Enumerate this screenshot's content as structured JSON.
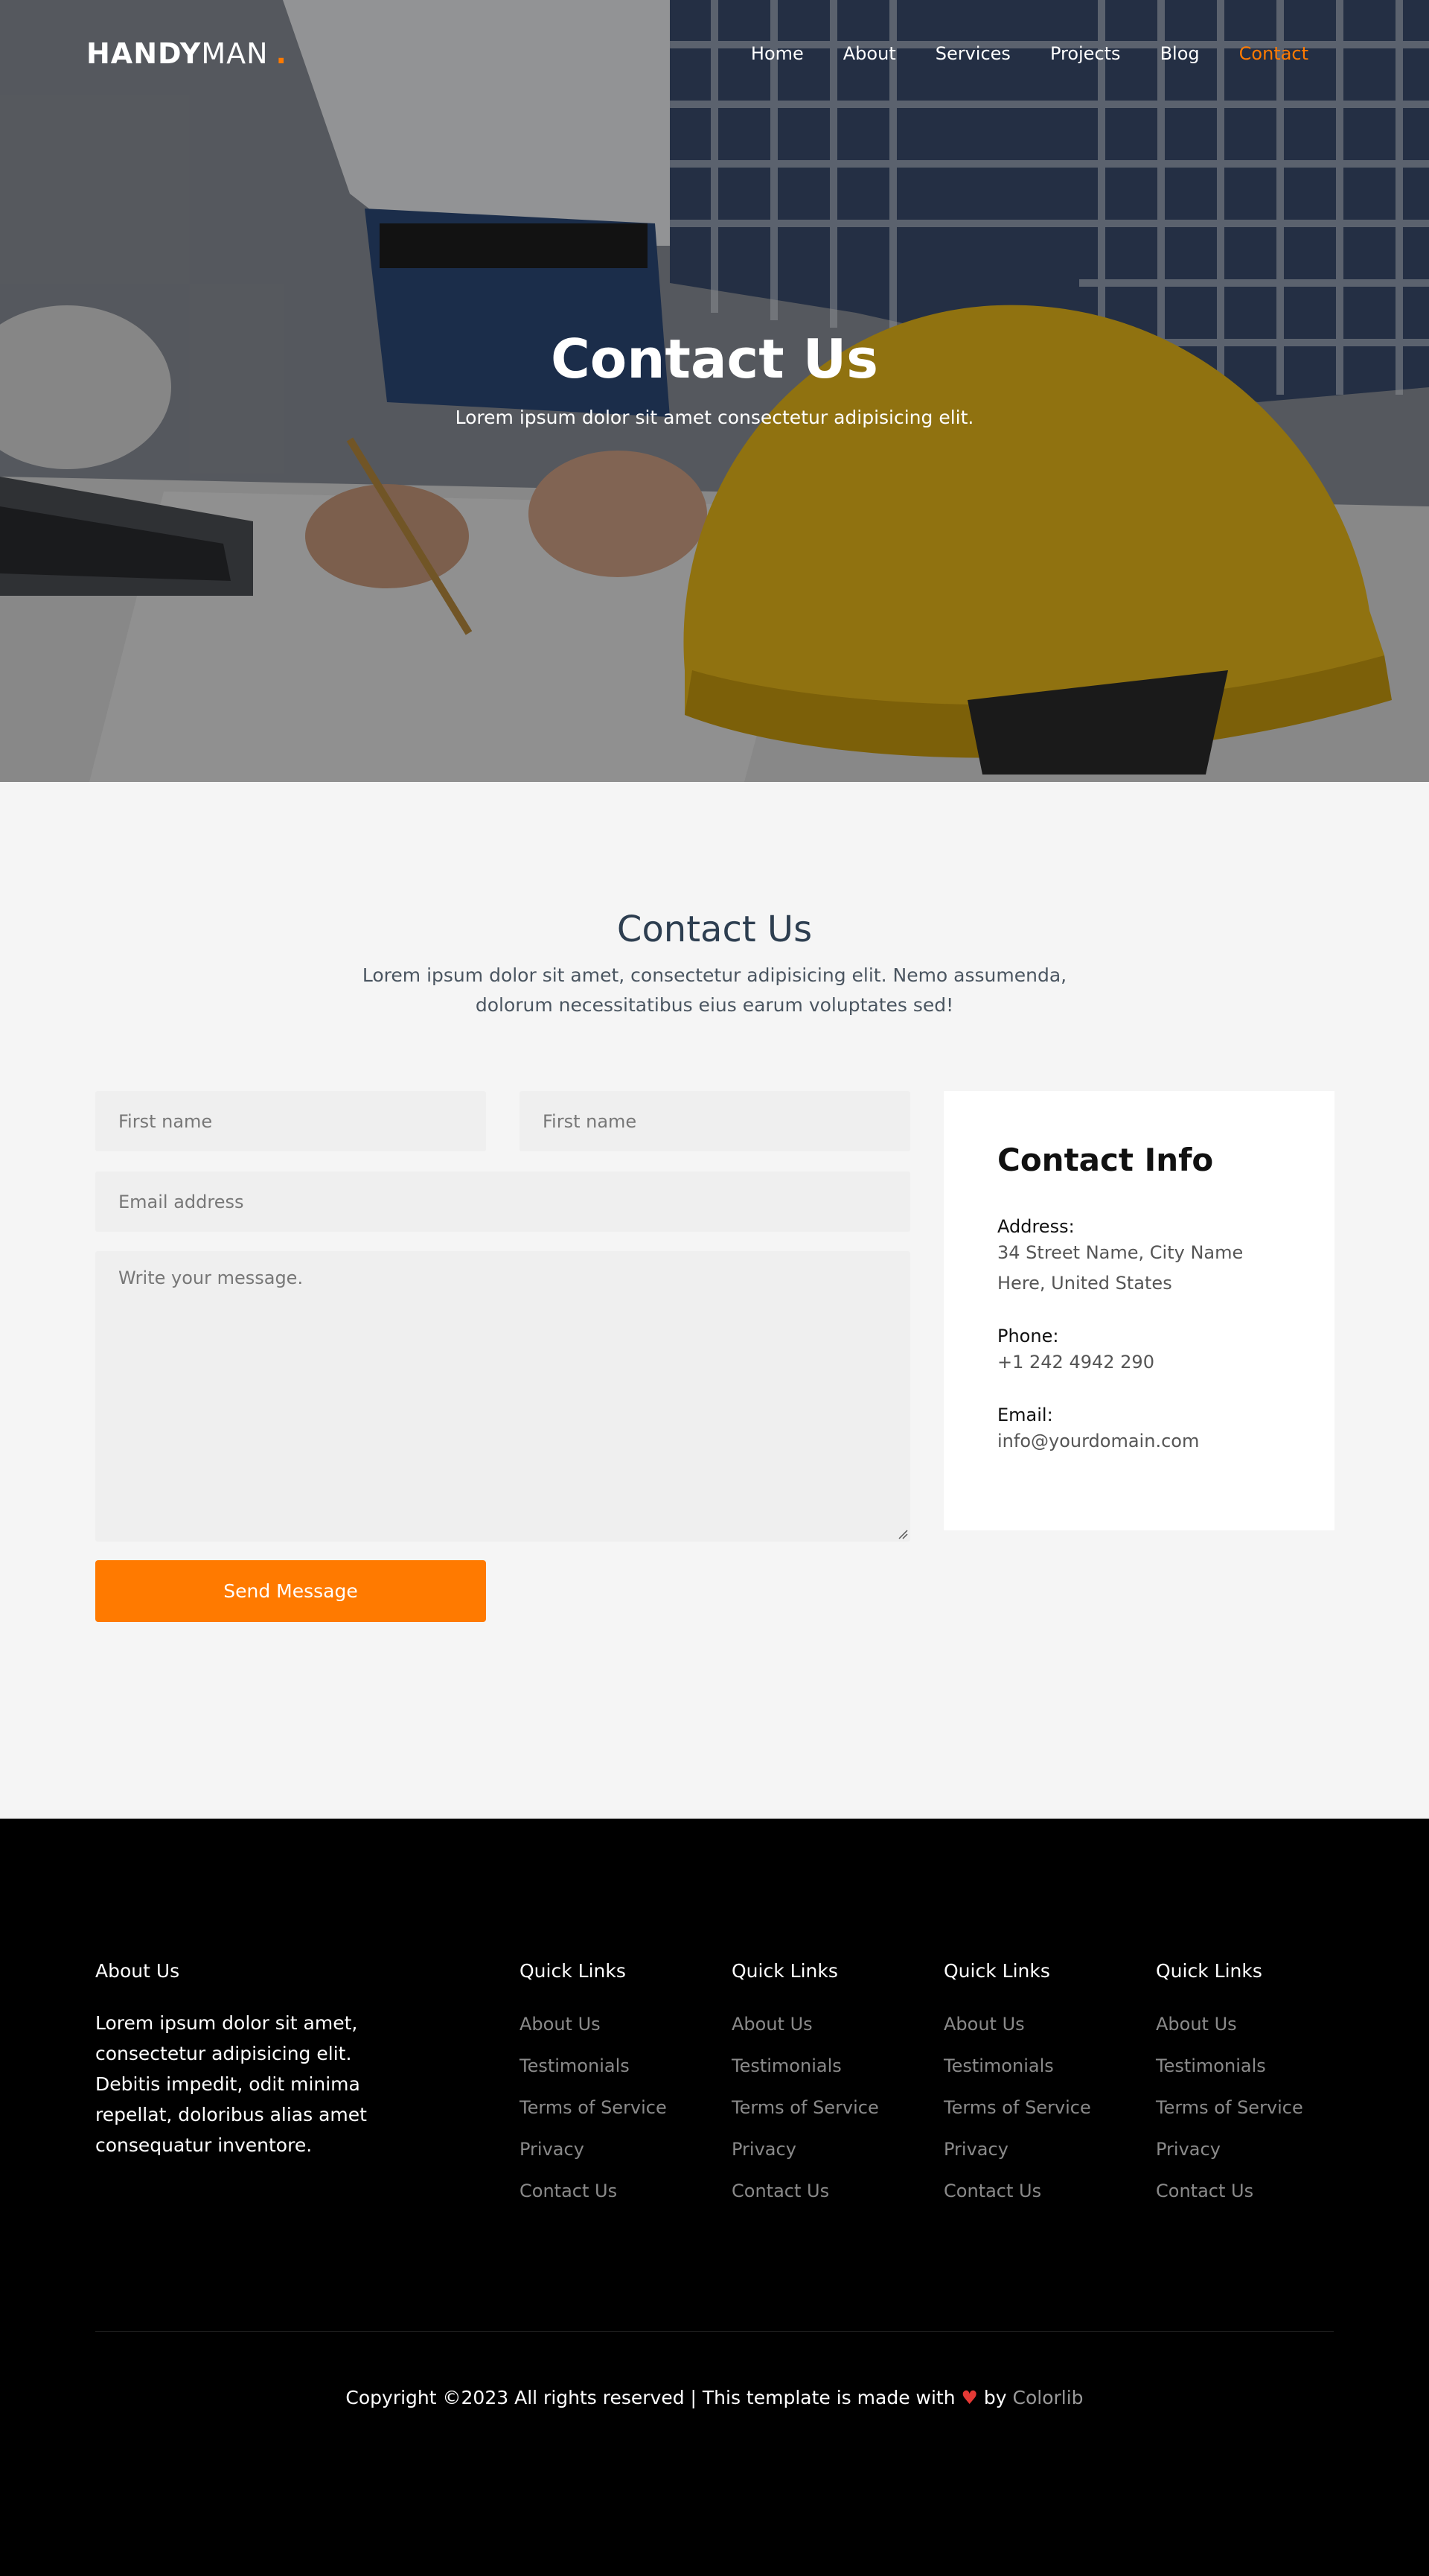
{
  "brand": {
    "bold": "HANDY",
    "light": "MAN",
    "dot": "."
  },
  "nav": {
    "items": [
      {
        "label": "Home"
      },
      {
        "label": "About"
      },
      {
        "label": "Services"
      },
      {
        "label": "Projects"
      },
      {
        "label": "Blog"
      },
      {
        "label": "Contact"
      }
    ],
    "active_color": "#ff7a00"
  },
  "hero": {
    "title": "Contact Us",
    "subtitle": "Lorem ipsum dolor sit amet consectetur adipisicing elit."
  },
  "contact": {
    "title": "Contact Us",
    "description": "Lorem ipsum dolor sit amet, consectetur adipisicing elit. Nemo assumenda, dolorum necessitatibus eius earum voluptates sed!",
    "form": {
      "first_name_placeholder": "First name",
      "second_name_placeholder": "First name",
      "email_placeholder": "Email address",
      "message_placeholder": "Write your message.",
      "send_label": "Send Message",
      "button_color": "#ff7a00"
    },
    "info": {
      "title": "Contact Info",
      "address_label": "Address:",
      "address_line1": "34 Street Name, City Name",
      "address_line2": "Here, United States",
      "phone_label": "Phone:",
      "phone": "+1 242 4942 290",
      "email_label": "Email:",
      "email": "info@yourdomain.com"
    }
  },
  "footer": {
    "about_heading": "About Us",
    "about_text": "Lorem ipsum dolor sit amet, consectetur adipisicing elit. Debitis impedit, odit minima repellat, doloribus alias amet consequatur inventore.",
    "link_columns": [
      {
        "heading": "Quick Links",
        "links": [
          "About Us",
          "Testimonials",
          "Terms of Service",
          "Privacy",
          "Contact Us"
        ]
      },
      {
        "heading": "Quick Links",
        "links": [
          "About Us",
          "Testimonials",
          "Terms of Service",
          "Privacy",
          "Contact Us"
        ]
      },
      {
        "heading": "Quick Links",
        "links": [
          "About Us",
          "Testimonials",
          "Terms of Service",
          "Privacy",
          "Contact Us"
        ]
      },
      {
        "heading": "Quick Links",
        "links": [
          "About Us",
          "Testimonials",
          "Terms of Service",
          "Privacy",
          "Contact Us"
        ]
      }
    ],
    "copyright_prefix": "Copyright ©2023 All rights reserved | This template is made with",
    "heart_icon": "heart-icon",
    "by_text": "by",
    "credit": "Colorlib"
  }
}
